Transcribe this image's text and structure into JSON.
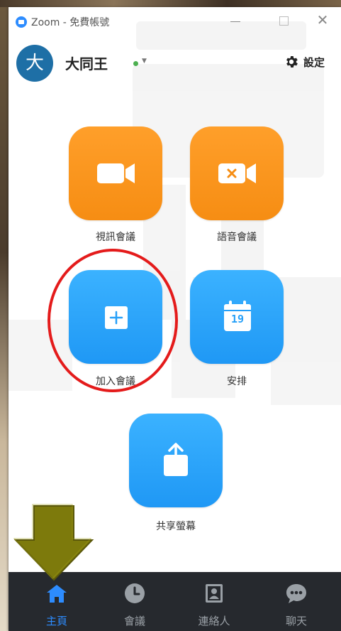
{
  "window": {
    "title": "Zoom - 免費帳號",
    "close_glyph": "✕"
  },
  "profile": {
    "avatar_char": "大",
    "name": "大同王",
    "status": "online",
    "status_color": "#4caf50",
    "settings_label": "設定"
  },
  "actions": [
    {
      "label": "視訊會議",
      "icon": "video-camera-icon",
      "color": "#f7921a"
    },
    {
      "label": "語音會議",
      "icon": "video-off-icon",
      "color": "#f7921a"
    },
    {
      "label": "加入會議",
      "icon": "plus-icon",
      "color": "#27a0f8"
    },
    {
      "label": "安排",
      "icon": "calendar-icon",
      "color": "#27a0f8",
      "calendar_day": "19"
    },
    {
      "label": "共享螢幕",
      "icon": "share-upload-icon",
      "color": "#27a0f8"
    }
  ],
  "nav": [
    {
      "label": "主頁",
      "icon": "home-icon",
      "active": true
    },
    {
      "label": "會議",
      "icon": "clock-icon",
      "active": false
    },
    {
      "label": "連絡人",
      "icon": "contact-card-icon",
      "active": false
    },
    {
      "label": "聊天",
      "icon": "chat-bubble-icon",
      "active": false
    }
  ],
  "colors": {
    "accent": "#2d8cff",
    "nav_bg": "#26292e",
    "annotation_circle": "#e41b1b",
    "annotation_arrow": "#7d7a0c"
  }
}
